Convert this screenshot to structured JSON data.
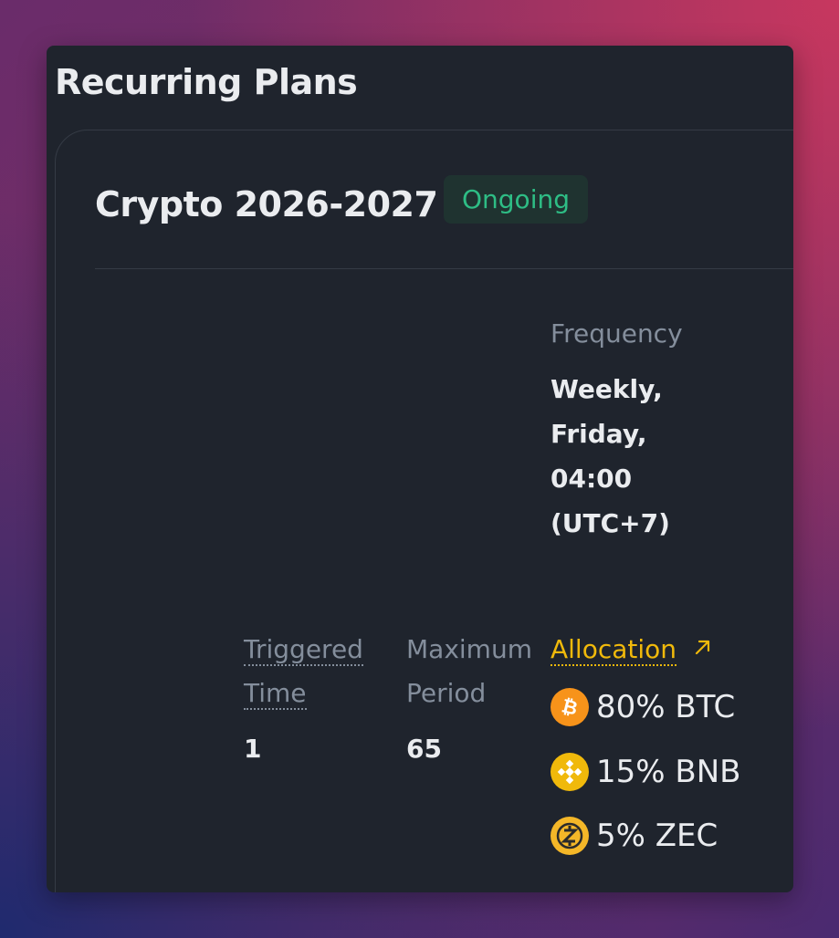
{
  "page": {
    "title": "Recurring Plans"
  },
  "plan": {
    "name": "Crypto 2026-2027",
    "status": "Ongoing",
    "frequency_label": "Frequency",
    "frequency_value": "Weekly, Friday, 04:00 (UTC+7)",
    "triggered_time_label": "Triggered Time",
    "triggered_time_value": "1",
    "maximum_period_label": "Maximum Period",
    "maximum_period_value": "65",
    "allocation_label": "Allocation",
    "allocation": [
      {
        "label": "80% BTC",
        "icon": "bitcoin-icon",
        "color": "#f7931a"
      },
      {
        "label": "15% BNB",
        "icon": "bnb-icon",
        "color": "#f0b90b"
      },
      {
        "label": "5% ZEC",
        "icon": "zcash-icon",
        "color": "#f4b728"
      }
    ]
  },
  "colors": {
    "background": "#1f242d",
    "accent": "#f0b90b",
    "status_green": "#2ebd85",
    "muted_text": "#848e9c",
    "primary_text": "#eaecef"
  }
}
